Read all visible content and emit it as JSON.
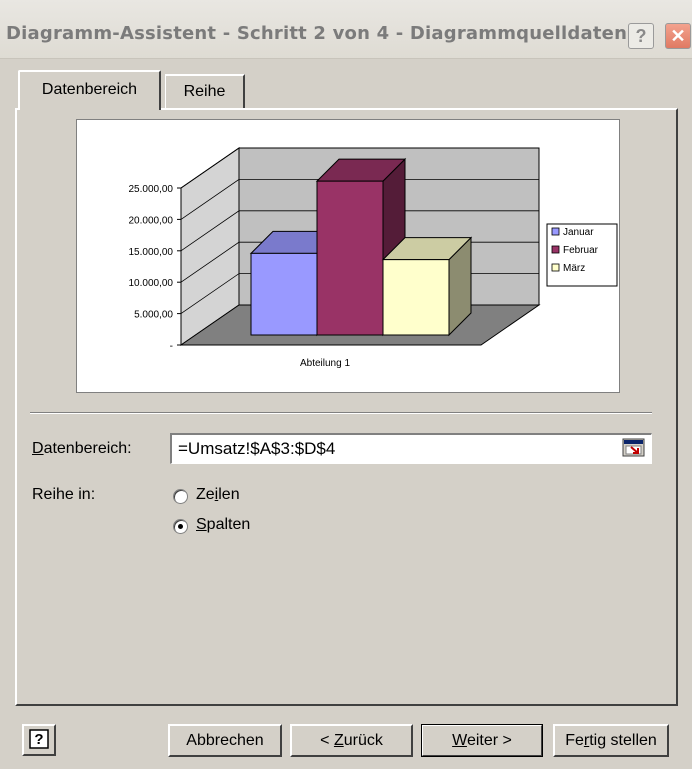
{
  "window": {
    "title": "Diagramm-Assistent - Schritt 2 von 4 - Diagrammquelldaten",
    "help_glyph": "?",
    "close_glyph": "✕"
  },
  "tabs": [
    {
      "label": "Datenbereich",
      "active": true
    },
    {
      "label": "Reihe",
      "active": false
    }
  ],
  "chart_data": {
    "type": "bar",
    "categories": [
      "Abteilung 1"
    ],
    "series": [
      {
        "name": "Januar",
        "values": [
          13000
        ],
        "color": "#9999ff"
      },
      {
        "name": "Februar",
        "values": [
          24500
        ],
        "color": "#993366"
      },
      {
        "name": "März",
        "values": [
          12000
        ],
        "color": "#ffffcc"
      }
    ],
    "ylim": [
      0,
      25000
    ],
    "y_ticks": [
      "-",
      "5.000,00",
      "10.000,00",
      "15.000,00",
      "20.000,00",
      "25.000,00"
    ],
    "legend_labels": [
      "Januar",
      "Februar",
      "März"
    ],
    "legend": "right",
    "grid": true
  },
  "form": {
    "range_label": "Datenbereich:",
    "range_value": "=Umsatz!$A$3:$D$4",
    "series_in_label": "Reihe in:",
    "options": [
      {
        "label": "Zeilen",
        "selected": false
      },
      {
        "label": "Spalten",
        "selected": true
      }
    ]
  },
  "buttons": {
    "help_glyph": "?",
    "cancel": "Abbrechen",
    "back": "< Zurück",
    "next": "Weiter >",
    "finish": "Fertig stellen"
  }
}
